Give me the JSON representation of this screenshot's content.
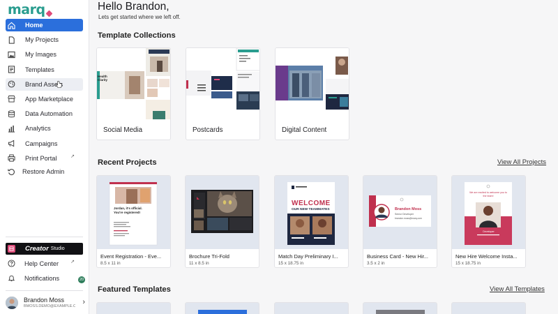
{
  "brand": {
    "logo_text": "marq",
    "accent": "#2b6fdc",
    "teal": "#2a9d8f",
    "pink": "#e04b7a"
  },
  "sidebar": {
    "items": [
      {
        "label": "Home",
        "icon": "home-icon"
      },
      {
        "label": "My Projects",
        "icon": "file-icon"
      },
      {
        "label": "My Images",
        "icon": "image-icon"
      },
      {
        "label": "Templates",
        "icon": "templates-icon"
      },
      {
        "label": "Brand Assets",
        "icon": "palette-icon"
      },
      {
        "label": "App Marketplace",
        "icon": "store-icon"
      },
      {
        "label": "Data Automation",
        "icon": "database-icon"
      },
      {
        "label": "Analytics",
        "icon": "bar-chart-icon"
      },
      {
        "label": "Campaigns",
        "icon": "megaphone-icon"
      },
      {
        "label": "Print Portal",
        "icon": "printer-icon"
      }
    ],
    "restore_admin": "Restore Admin",
    "creator": {
      "name": "Creator",
      "sub": "Studio"
    },
    "help_center": "Help Center",
    "notifications": "Notifications",
    "notifications_badge": "20",
    "user": {
      "name": "Brandon Moss",
      "email": "BMOSS.DEMO@EXAMPLE.C..."
    }
  },
  "main": {
    "greeting": "Hello Brandon,",
    "greeting_sub": "Lets get started where we left off.",
    "template_collections_title": "Template Collections",
    "collections": [
      {
        "label": "Social Media"
      },
      {
        "label": "Postcards"
      },
      {
        "label": "Digital Content"
      }
    ],
    "recent_projects_title": "Recent Projects",
    "view_all_projects": "View All Projects",
    "projects": [
      {
        "title": "Event Registration - Eve...",
        "size": "8.5 x 11 in"
      },
      {
        "title": "Brochure Tri-Fold",
        "size": "11 x 8.5 in"
      },
      {
        "title": "Match Day Preliminary I...",
        "size": "15 x 18.75 in"
      },
      {
        "title": "Business Card - New Hir...",
        "size": "3.5 x 2 in"
      },
      {
        "title": "New Hire Welcome Insta...",
        "size": "15 x 18.75 in"
      }
    ],
    "featured_templates_title": "Featured Templates",
    "view_all_templates": "View All Templates",
    "thumb_text": {
      "social_health": "Health Clarity",
      "welcome": "WELCOME",
      "new_teammates": "OUR NEW TEAMMATES",
      "event_heading": "Jordan, it's official. You're registered!",
      "card_name": "Brandon Moss",
      "card_role": "Senior Developer",
      "card_email": "brandon.moss@marq.com",
      "welcome_msg": "We are excited to welcome you to the team!",
      "new_hire_role": "Developer"
    }
  }
}
